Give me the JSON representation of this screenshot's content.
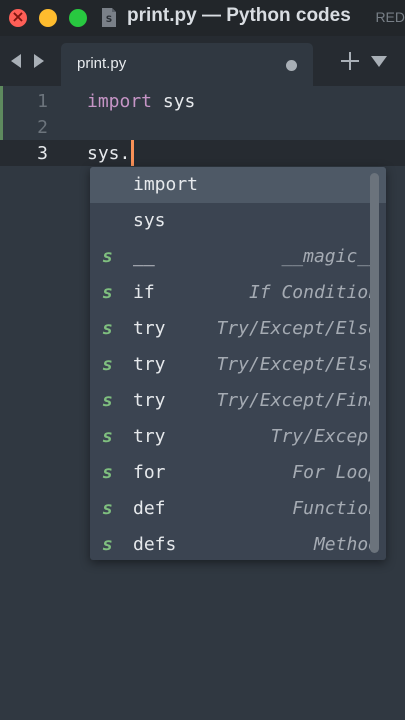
{
  "window": {
    "title": "print.py — Python codes",
    "title_tail": "RED"
  },
  "tabs": [
    {
      "label": "print.py",
      "modified": true
    }
  ],
  "editor": {
    "lines": [
      {
        "number": "1",
        "keyword": "import",
        "rest": " sys"
      },
      {
        "number": "2",
        "keyword": "",
        "rest": ""
      },
      {
        "number": "3",
        "keyword": "",
        "rest": "sys."
      }
    ],
    "current_line": "3"
  },
  "autocomplete": {
    "items": [
      {
        "kind": "",
        "trigger": "import",
        "annotation": "",
        "selected": true
      },
      {
        "kind": "",
        "trigger": "sys",
        "annotation": ""
      },
      {
        "kind": "s",
        "trigger": "__",
        "annotation": "__magic__"
      },
      {
        "kind": "s",
        "trigger": "if",
        "annotation": "If Condition"
      },
      {
        "kind": "s",
        "trigger": "try",
        "annotation": "Try/Except/Else"
      },
      {
        "kind": "s",
        "trigger": "try",
        "annotation": "Try/Except/Else"
      },
      {
        "kind": "s",
        "trigger": "try",
        "annotation": "Try/Except/Fina"
      },
      {
        "kind": "s",
        "trigger": "try",
        "annotation": "Try/Except"
      },
      {
        "kind": "s",
        "trigger": "for",
        "annotation": "For Loop"
      },
      {
        "kind": "s",
        "trigger": "def",
        "annotation": "Function"
      },
      {
        "kind": "s",
        "trigger": "defs",
        "annotation": "Method"
      }
    ]
  },
  "icons": {
    "close": "close-icon",
    "minimize": "minimize-icon",
    "zoom": "zoom-icon",
    "file": "python-file-icon",
    "nav_back": "arrow-left-icon",
    "nav_forward": "arrow-right-icon",
    "new_tab": "plus-icon",
    "tab_menu": "chevron-down-icon"
  },
  "colors": {
    "background": "#303841",
    "keyword": "#c695c6",
    "caret": "#f99157",
    "snippet_kind": "#7fbf7f"
  }
}
